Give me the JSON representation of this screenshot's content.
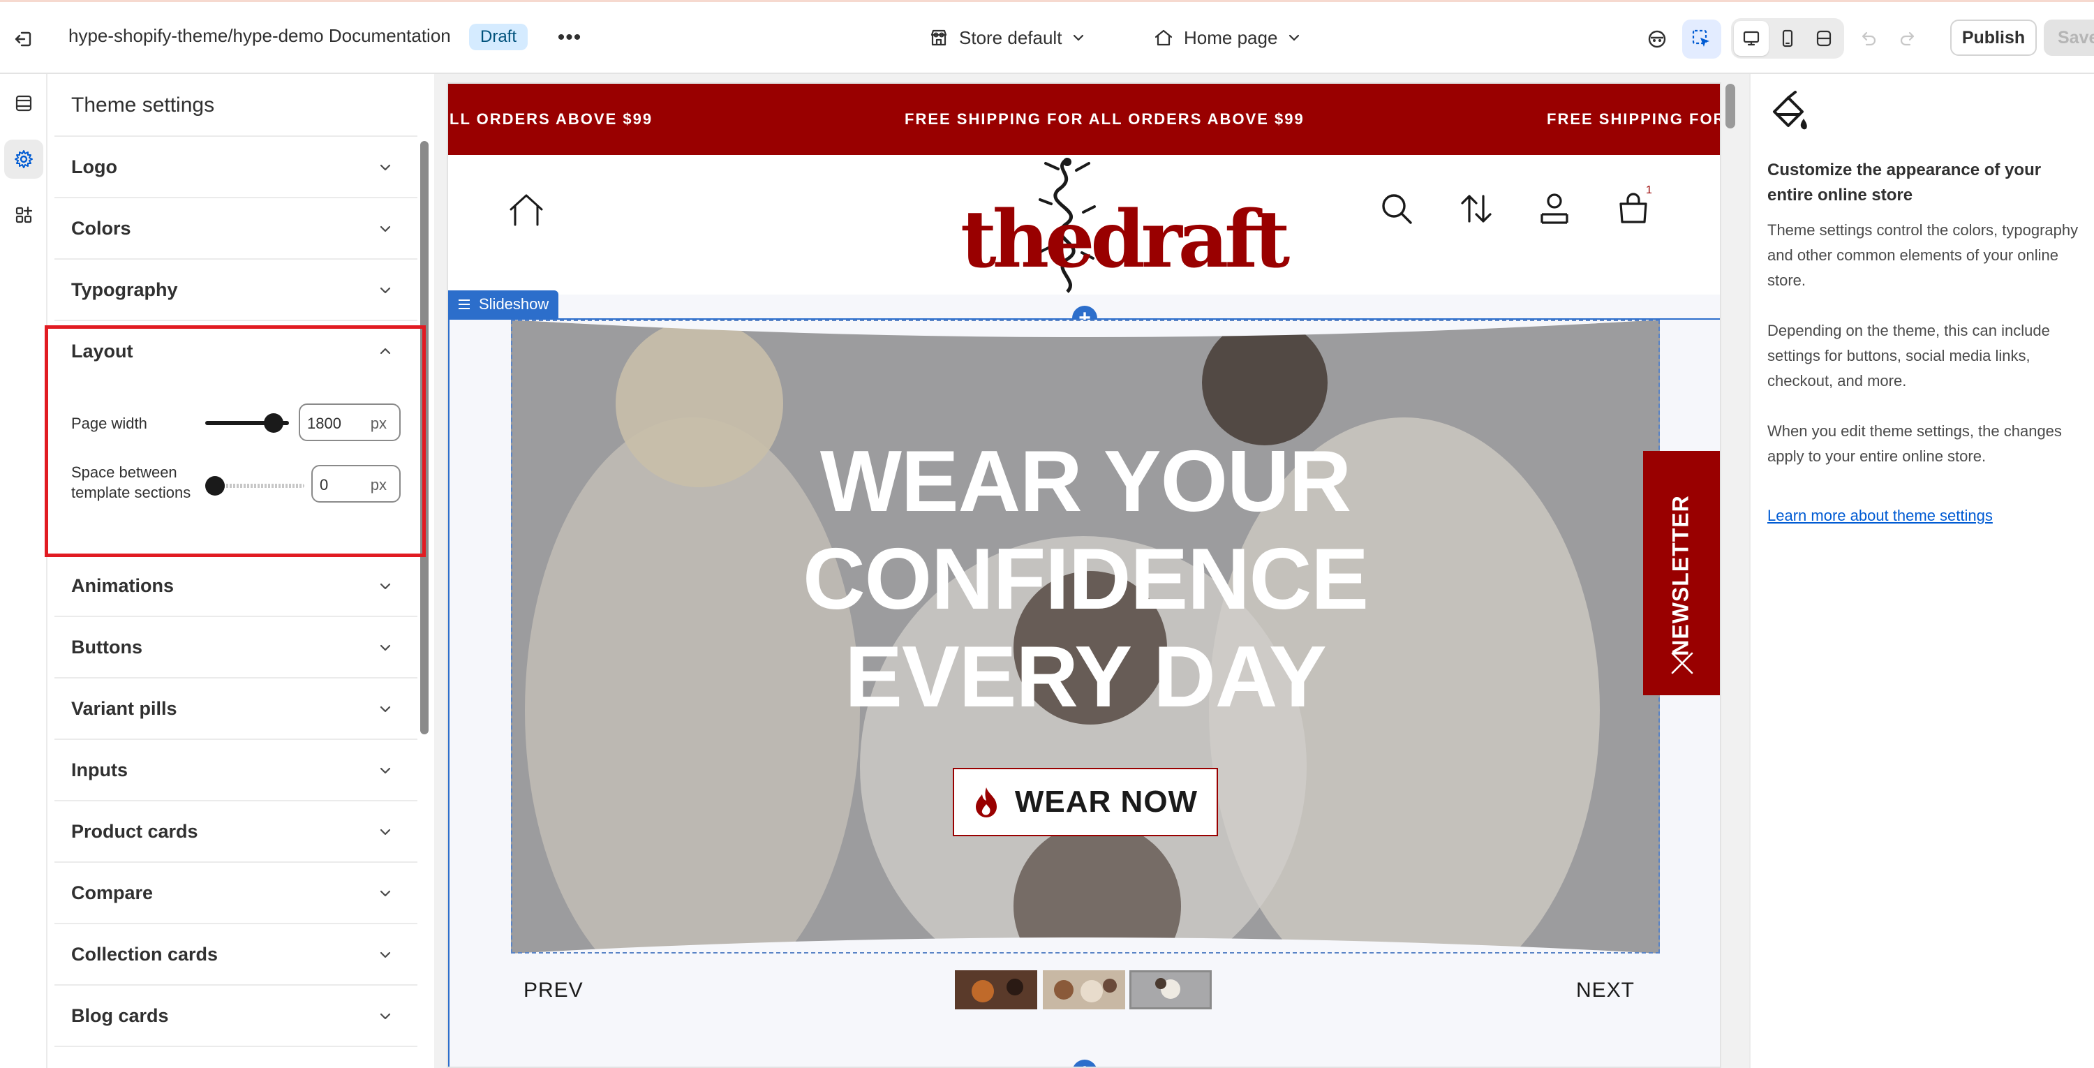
{
  "topbar": {
    "title": "hype-shopify-theme/hype-demo Documentation",
    "badge": "Draft",
    "more": "•••",
    "store_selector": "Store default",
    "page_selector": "Home page",
    "publish": "Publish",
    "save": "Save"
  },
  "panel": {
    "title": "Theme settings",
    "sections": [
      {
        "label": "Logo",
        "expanded": false
      },
      {
        "label": "Colors",
        "expanded": false
      },
      {
        "label": "Typography",
        "expanded": false
      },
      {
        "label": "Layout",
        "expanded": true
      },
      {
        "label": "Animations",
        "expanded": false
      },
      {
        "label": "Buttons",
        "expanded": false
      },
      {
        "label": "Variant pills",
        "expanded": false
      },
      {
        "label": "Inputs",
        "expanded": false
      },
      {
        "label": "Product cards",
        "expanded": false
      },
      {
        "label": "Compare",
        "expanded": false
      },
      {
        "label": "Collection cards",
        "expanded": false
      },
      {
        "label": "Blog cards",
        "expanded": false
      }
    ],
    "layout": {
      "page_width": {
        "label": "Page width",
        "value": "1800",
        "unit": "px",
        "fraction": 0.82
      },
      "space_between": {
        "label": "Space between template sections",
        "value": "0",
        "unit": "px",
        "fraction": 0.0
      }
    }
  },
  "preview": {
    "announcement": "FREE SHIPPING FOR ALL ORDERS ABOVE $99",
    "announcement_left": "LL ORDERS ABOVE $99",
    "announcement_right": "FREE SHIPPING FOR",
    "logo": "thedraft",
    "cart_count": "1",
    "section_tag": "Slideshow",
    "hero": {
      "line1": "WEAR YOUR",
      "line2": "CONFIDENCE",
      "line3": "EVERY DAY",
      "button": "WEAR NOW"
    },
    "newsletter": "NEWSLETTER",
    "prev": "PREV",
    "next": "NEXT",
    "active_slide": 3,
    "add_symbol": "+"
  },
  "info": {
    "heading": "Customize the appearance of your entire online store",
    "p1": "Theme settings control the colors, typography and other common elements of your online store.",
    "p2": "Depending on the theme, this can include settings for buttons, social media links, checkout, and more.",
    "p3": "When you edit theme settings, the changes apply to your entire online store.",
    "link": "Learn more about theme settings"
  },
  "colors": {
    "brand": "#990000",
    "selection": "#2c6ecb",
    "highlight": "#e11b22",
    "draft_badge": "#d5ebff"
  },
  "icons": {
    "exit": "exit-icon",
    "sections": "sections-icon",
    "settings": "gear-icon",
    "apps": "apps-icon",
    "store": "store-icon",
    "home": "home-icon",
    "search": "search-icon",
    "sort": "sort-icon",
    "account": "account-icon",
    "cart": "cart-icon",
    "flame": "flame-icon",
    "paint": "paint-bucket-icon"
  }
}
